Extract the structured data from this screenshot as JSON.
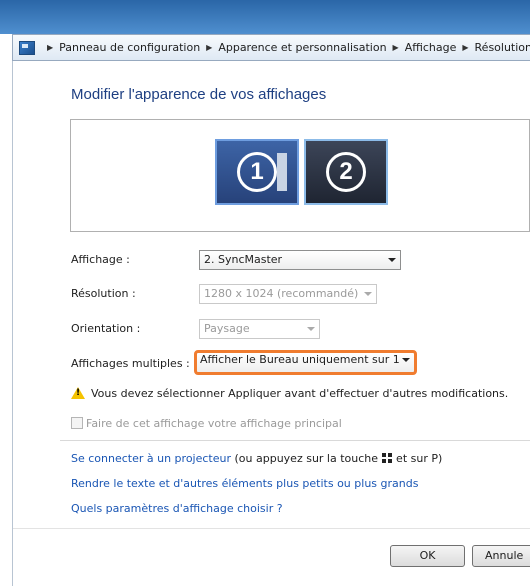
{
  "breadcrumb": {
    "items": [
      "Panneau de configuration",
      "Apparence et personnalisation",
      "Affichage",
      "Résolution"
    ],
    "icon": "control-panel-icon"
  },
  "page": {
    "title": "Modifier l'apparence de vos affichages"
  },
  "monitors": [
    {
      "number": "1",
      "selected": false
    },
    {
      "number": "2",
      "selected": true
    }
  ],
  "settings": {
    "display": {
      "label": "Affichage :",
      "value": "2. SyncMaster"
    },
    "resolution": {
      "label": "Résolution :",
      "value": "1280 x 1024 (recommandé)"
    },
    "orientation": {
      "label": "Orientation :",
      "value": "Paysage"
    },
    "multiple": {
      "label": "Affichages multiples :",
      "value": "Afficher le Bureau uniquement sur 1"
    }
  },
  "warning": {
    "text": "Vous devez sélectionner Appliquer avant d'effectuer d'autres modifications.",
    "icon": "warning-icon"
  },
  "checkbox": {
    "label": "Faire de cet affichage votre affichage principal",
    "checked": false
  },
  "links": {
    "projector": "Se connecter à un projecteur",
    "projector_hint_before": "(ou appuyez sur la touche",
    "projector_hint_after": "et sur P)",
    "text_size": "Rendre le texte et d'autres éléments plus petits ou plus grands",
    "which_settings": "Quels paramètres d'affichage choisir ?"
  },
  "buttons": {
    "ok": "OK",
    "cancel": "Annule"
  },
  "colors": {
    "highlight": "#f07c2f",
    "link": "#1a56b4",
    "title": "#1e3f82"
  }
}
